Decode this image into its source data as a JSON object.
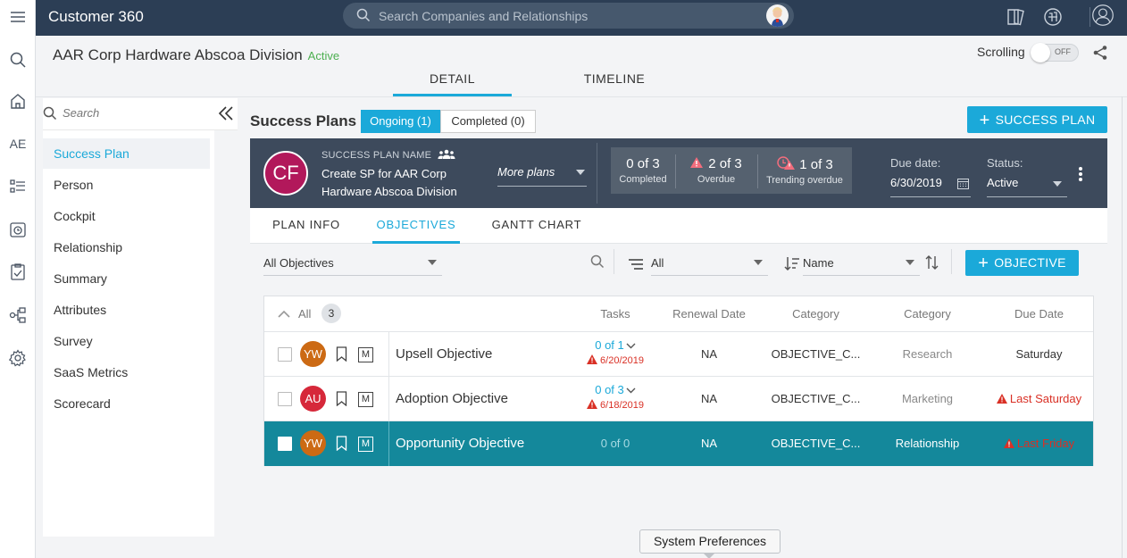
{
  "app": {
    "title": "Customer 360"
  },
  "topbar": {
    "search_placeholder": "Search Companies and Relationships"
  },
  "rail": {
    "ae_label": "AE"
  },
  "header": {
    "company_name": "AAR Corp Hardware Abscoa Division",
    "company_status": "Active",
    "tabs": [
      {
        "label": "DETAIL"
      },
      {
        "label": "TIMELINE"
      }
    ],
    "scrolling_label": "Scrolling",
    "scrolling_toggle": "OFF"
  },
  "leftnav": {
    "search_placeholder": "Search",
    "items": [
      {
        "label": "Success Plan"
      },
      {
        "label": "Person"
      },
      {
        "label": "Cockpit"
      },
      {
        "label": "Relationship"
      },
      {
        "label": "Summary"
      },
      {
        "label": "Attributes"
      },
      {
        "label": "Survey"
      },
      {
        "label": "SaaS Metrics"
      },
      {
        "label": "Scorecard"
      }
    ]
  },
  "plans": {
    "title": "Success Plans",
    "ongoing_label": "Ongoing (1)",
    "completed_label": "Completed (0)",
    "add_button": "SUCCESS PLAN"
  },
  "plan_card": {
    "initials": "CF",
    "name_label": "SUCCESS PLAN NAME",
    "name_line1": "Create SP for AAR Corp",
    "name_line2": "Hardware Abscoa Division",
    "more_plans": "More plans",
    "completed_value": "0 of 3",
    "completed_label": "Completed",
    "overdue_value": "2 of 3",
    "overdue_label": "Overdue",
    "trending_value": "1 of 3",
    "trending_label": "Trending overdue",
    "due_label": "Due date:",
    "due_value": "6/30/2019",
    "status_label": "Status:",
    "status_value": "Active"
  },
  "subtabs": [
    {
      "label": "PLAN INFO"
    },
    {
      "label": "OBJECTIVES"
    },
    {
      "label": "GANTT CHART"
    }
  ],
  "filters": {
    "objectives_filter": "All Objectives",
    "group_filter": "All",
    "sort_filter": "Name",
    "add_button": "OBJECTIVE"
  },
  "table": {
    "all_label": "All",
    "count": "3",
    "columns": [
      "Tasks",
      "Renewal Date",
      "Category",
      "Category",
      "Due Date"
    ],
    "rows": [
      {
        "initials": "YW",
        "avatar_color": "#cc6a14",
        "m": "M",
        "name": "Upsell Objective",
        "tasks": "0 of 1",
        "task_date": "6/20/2019",
        "renewal": "NA",
        "category": "OBJECTIVE_C...",
        "category2": "Research",
        "due": "Saturday"
      },
      {
        "initials": "AU",
        "avatar_color": "#d6283a",
        "m": "M",
        "name": "Adoption Objective",
        "tasks": "0 of 3",
        "task_date": "6/18/2019",
        "renewal": "NA",
        "category": "OBJECTIVE_C...",
        "category2": "Marketing",
        "due": "Last Saturday"
      },
      {
        "initials": "YW",
        "avatar_color": "#cc6a14",
        "m": "M",
        "name": "Opportunity Objective",
        "tasks": "0 of 0",
        "renewal": "NA",
        "category": "OBJECTIVE_C...",
        "category2": "Relationship",
        "due": "Last Friday"
      }
    ]
  },
  "tooltip": {
    "label": "System Preferences"
  },
  "colors": {
    "accent": "#1ba9d9",
    "topbar": "#2c3e55",
    "card": "#3d4a5c",
    "selected_row": "#14889b",
    "overdue": "#d93025"
  }
}
